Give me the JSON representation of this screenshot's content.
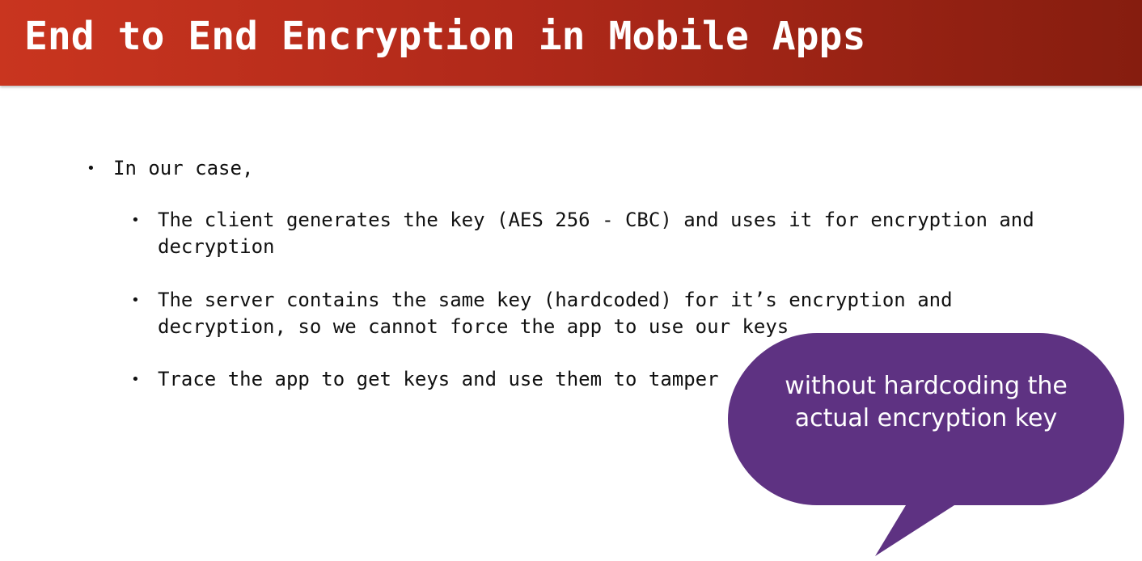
{
  "slide": {
    "title": "End to End Encryption in Mobile Apps",
    "bullets": {
      "top": "In our case,",
      "items": [
        "The client generates the key (AES 256 - CBC) and uses it for encryption and decryption",
        "The server contains the same key (hardcoded) for it’s encryption and decryption, so we cannot force the app to use our keys",
        "Trace the app to get keys and use them to tamper"
      ]
    },
    "callout": {
      "text": "without hardcoding the actual encryption key"
    }
  },
  "colors": {
    "title_bar_start": "#c9351f",
    "title_bar_end": "#861d0f",
    "callout_fill": "#5e3282",
    "text": "#111111"
  }
}
